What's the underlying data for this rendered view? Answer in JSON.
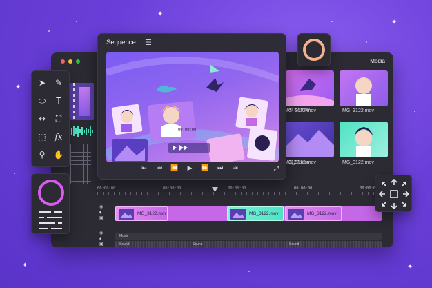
{
  "window": {
    "dots": [
      "#ff5f57",
      "#ffbd2e",
      "#28c840"
    ],
    "media_title": "Media"
  },
  "sequence": {
    "title": "Sequence",
    "menu_icon": "hamburger-icon",
    "viewer_timecode": "00:00:00"
  },
  "media": {
    "items": [
      {
        "label": "MG_3122.mov"
      },
      {
        "label": "MG_3122.mov"
      },
      {
        "label": "MG_3122.mov"
      },
      {
        "label": "MG_3122.mov"
      }
    ],
    "left_labels": [
      "3122.mov",
      "3122.mov"
    ]
  },
  "playback": {
    "icons": [
      "trim-left-icon",
      "skip-back-icon",
      "rewind-icon",
      "play-icon",
      "fast-forward-icon",
      "skip-forward-icon",
      "trim-right-icon"
    ],
    "expand_icon": "expand-icon"
  },
  "timeline": {
    "timecodes": [
      "00:00:00",
      "00:00:00",
      "00:00:00",
      "00:00:00",
      "00:00:00"
    ],
    "clips": [
      {
        "label": "MG_3122.mov"
      },
      {
        "label": "MG_3122.mov"
      },
      {
        "label": "MG_3122.mov"
      }
    ],
    "audio": {
      "music_label": "Music",
      "sound_labels": [
        "Sound",
        "Sound",
        "Sound"
      ]
    }
  },
  "tools": [
    "select-icon",
    "pen-icon",
    "ellipse-icon",
    "text-icon",
    "resize-icon",
    "crop-icon",
    "marquee-icon",
    "function-icon",
    "pin-icon",
    "hand-icon"
  ],
  "colors": {
    "accent_pink": "#d85cf0",
    "accent_teal": "#4fe3c4",
    "ring_orange": "#f5b08f"
  }
}
